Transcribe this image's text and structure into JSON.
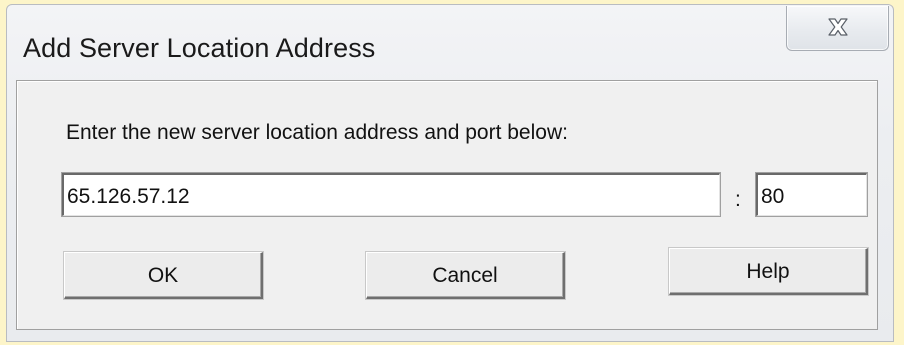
{
  "dialog": {
    "title": "Add Server Location Address",
    "prompt": "Enter the new server location address and port below:",
    "address_value": "65.126.57.12",
    "separator": ":",
    "port_value": "80",
    "buttons": {
      "ok": "OK",
      "cancel": "Cancel",
      "help": "Help"
    },
    "close_icon": "close-icon"
  },
  "colors": {
    "background": "#fdf5c9",
    "client_area": "#f0f0f0",
    "text": "#111111"
  }
}
